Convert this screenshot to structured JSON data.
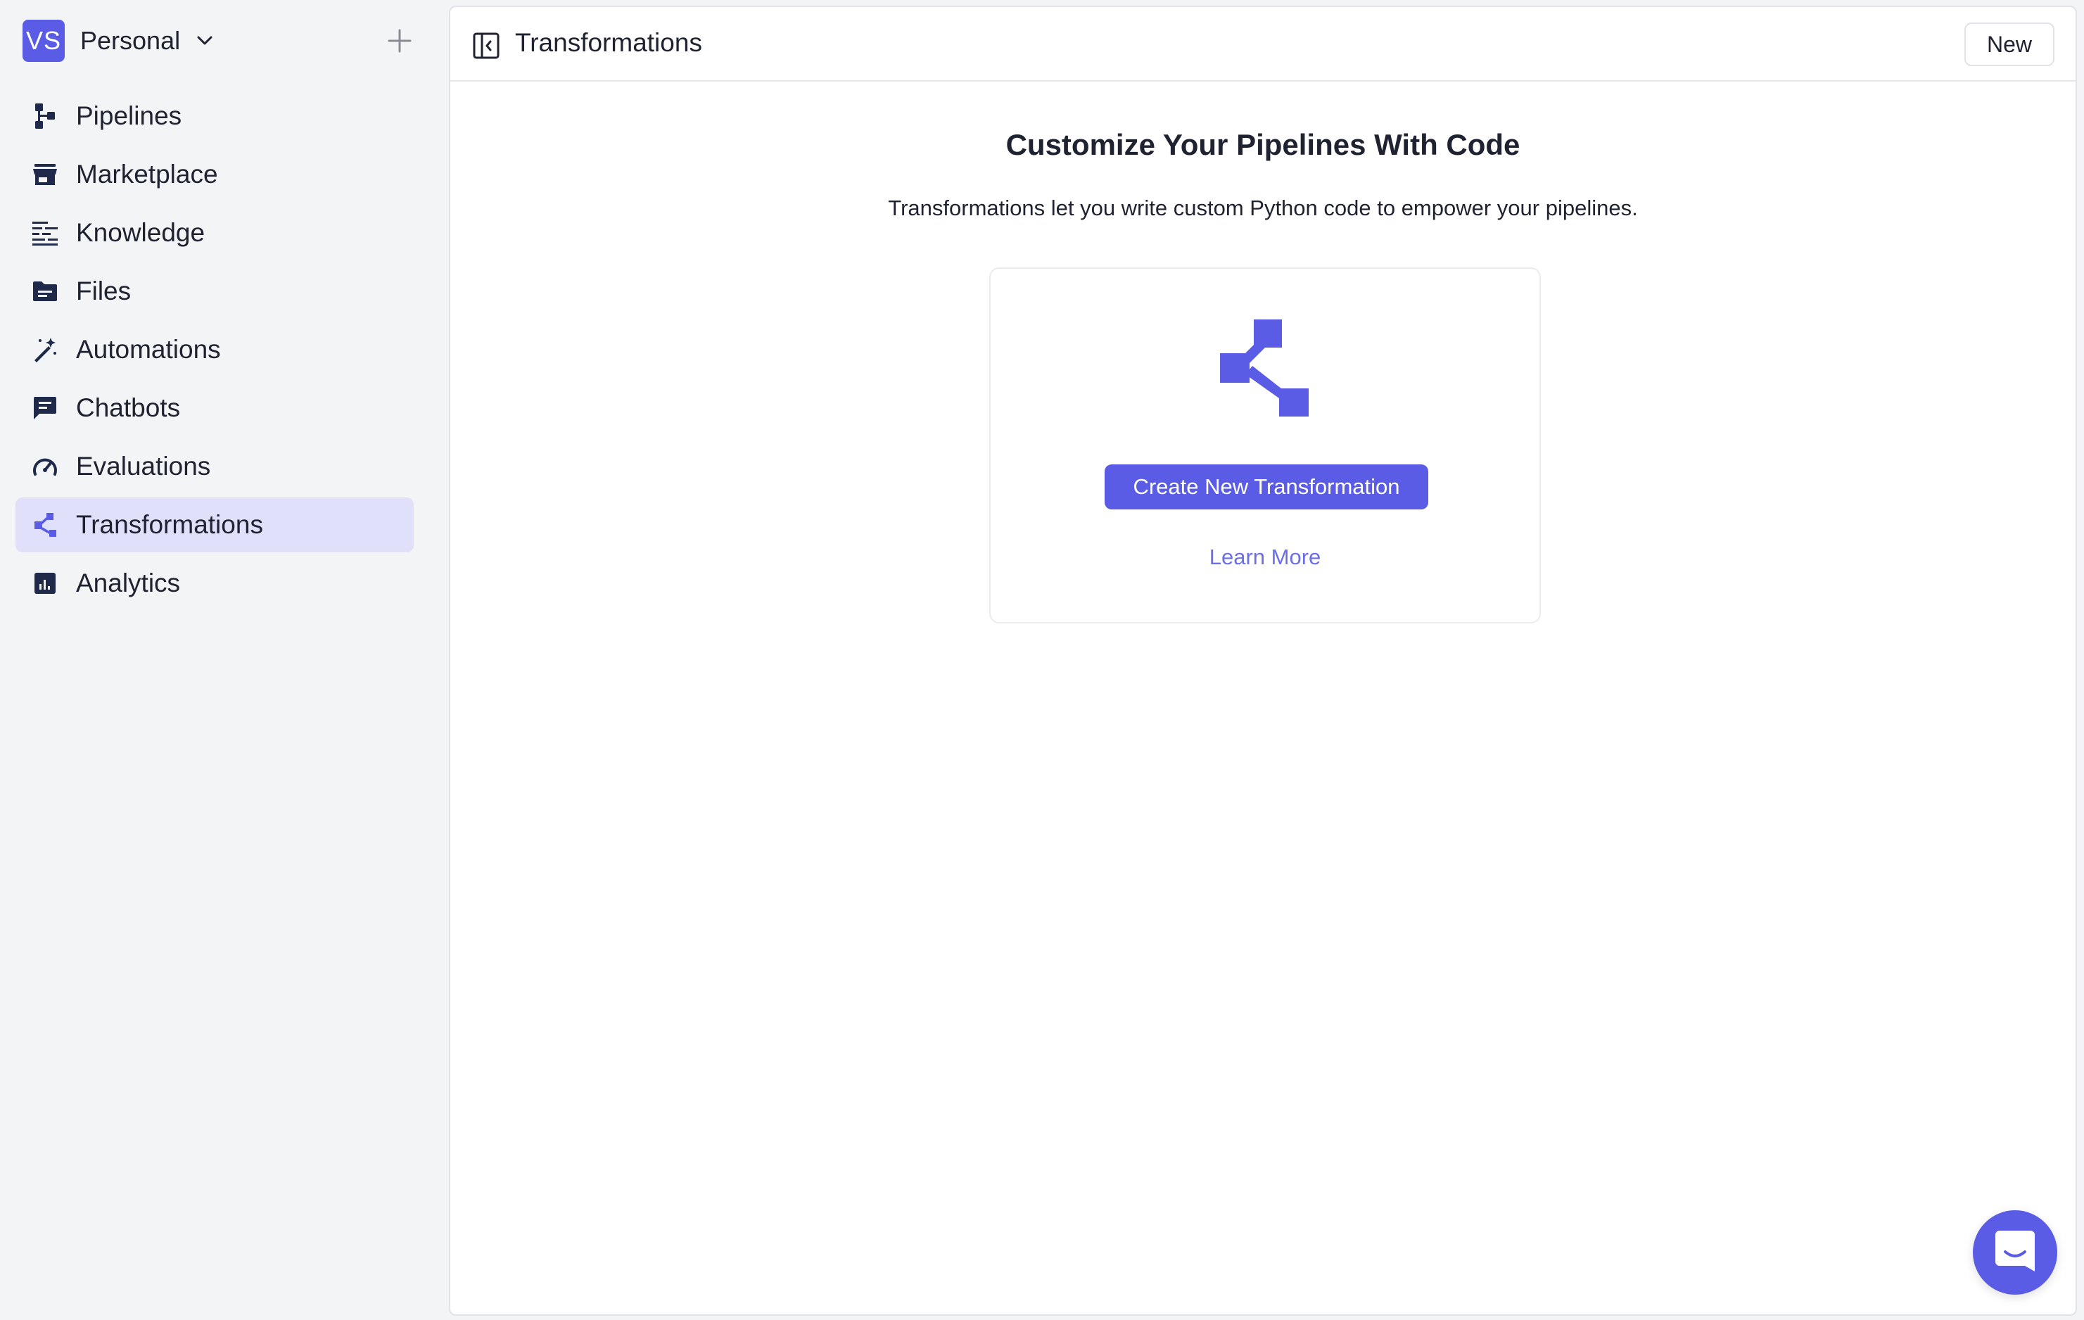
{
  "workspace": {
    "initials": "VS",
    "name": "Personal"
  },
  "sidebar": {
    "items": [
      {
        "label": "Pipelines",
        "icon": "pipelines-icon"
      },
      {
        "label": "Marketplace",
        "icon": "storefront-icon"
      },
      {
        "label": "Knowledge",
        "icon": "knowledge-icon"
      },
      {
        "label": "Files",
        "icon": "folder-icon"
      },
      {
        "label": "Automations",
        "icon": "magic-wand-icon"
      },
      {
        "label": "Chatbots",
        "icon": "chat-icon"
      },
      {
        "label": "Evaluations",
        "icon": "gauge-icon"
      },
      {
        "label": "Transformations",
        "icon": "transform-icon",
        "active": true
      },
      {
        "label": "Analytics",
        "icon": "analytics-icon"
      }
    ]
  },
  "header": {
    "title": "Transformations",
    "new_label": "New"
  },
  "empty_state": {
    "title": "Customize Your Pipelines With Code",
    "subtitle": "Transformations let you write custom Python code to empower your pipelines.",
    "create_label": "Create New Transformation",
    "learn_more_label": "Learn More"
  },
  "colors": {
    "accent": "#5b5ce6",
    "active_bg": "#e0e0fb",
    "sidebar_bg": "#f3f4f6",
    "link": "#6c6ee8"
  }
}
